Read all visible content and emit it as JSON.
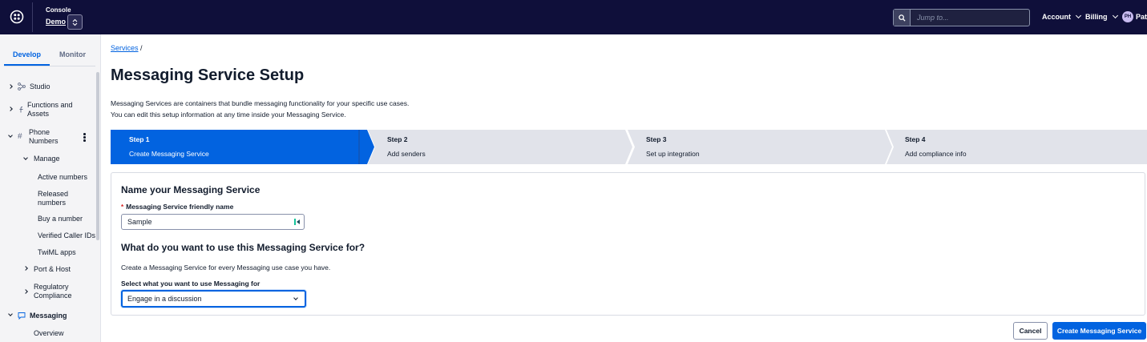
{
  "header": {
    "console_label": "Console",
    "project_name": "Demo",
    "search_placeholder": "Jump to...",
    "nav": [
      "Account",
      "Billing"
    ],
    "user_initials": "PH",
    "user_name": "Patr",
    "bg_color": "#0f0f3a"
  },
  "sidebar": {
    "tabs": [
      "Develop",
      "Monitor"
    ],
    "active_tab": "Develop",
    "items": {
      "studio": "Studio",
      "functions": "Functions and Assets",
      "phone_numbers": "Phone Numbers",
      "manage": "Manage",
      "active_numbers": "Active numbers",
      "released_numbers": "Released numbers",
      "buy_number": "Buy a number",
      "verified_caller_ids": "Verified Caller IDs",
      "twiml_apps": "TwiML apps",
      "port_host": "Port & Host",
      "regulatory": "Regulatory Compliance",
      "messaging": "Messaging",
      "overview": "Overview"
    }
  },
  "main": {
    "breadcrumb": "Services",
    "breadcrumb_sep": "/",
    "title": "Messaging Service Setup",
    "desc_line1": "Messaging Services are containers that bundle messaging functionality for your specific use cases.",
    "desc_line2": "You can edit this setup information at any time inside your Messaging Service.",
    "steps": [
      {
        "num": "Step 1",
        "label": "Create Messaging Service",
        "active": true
      },
      {
        "num": "Step 2",
        "label": "Add senders",
        "active": false
      },
      {
        "num": "Step 3",
        "label": "Set up integration",
        "active": false
      },
      {
        "num": "Step 4",
        "label": "Add compliance info",
        "active": false
      }
    ],
    "form": {
      "heading": "Name your Messaging Service",
      "required_mark": "*",
      "name_label": "Messaging Service friendly name",
      "name_value": "Sample",
      "use_heading": "What do you want to use this Messaging Service for?",
      "use_sub": "Create a Messaging Service for every Messaging use case you have.",
      "select_label": "Select what you want to use Messaging for",
      "select_value": "Engage in a discussion"
    },
    "buttons": {
      "cancel": "Cancel",
      "create": "Create Messaging Service"
    },
    "colors": {
      "primary": "#0263e0",
      "step_inactive": "#e1e3ea"
    }
  }
}
